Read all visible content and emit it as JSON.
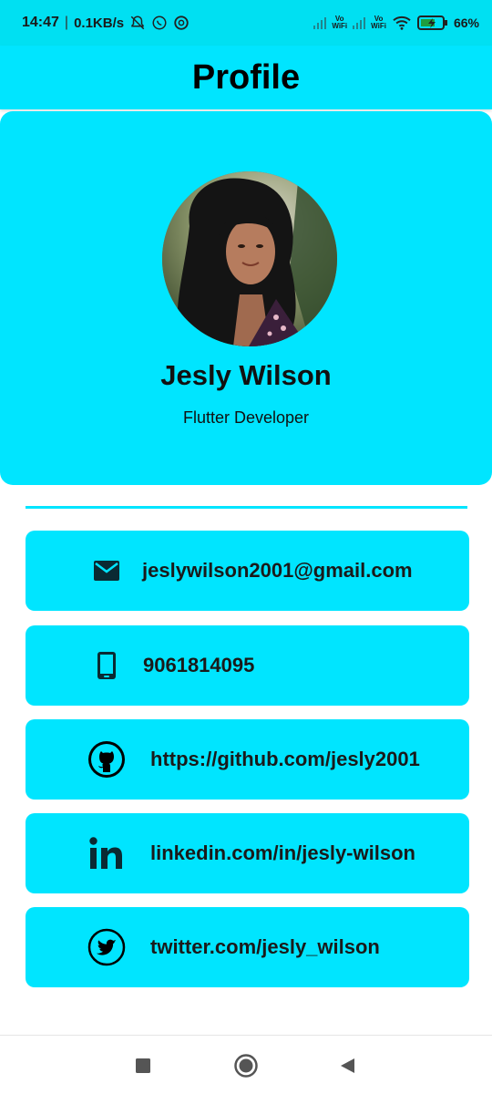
{
  "status_bar": {
    "time": "14:47",
    "net_rate": "0.1KB/s",
    "vowifi_top": "Vo",
    "vowifi_bottom": "WiFi",
    "battery": "66%"
  },
  "app_bar": {
    "title": "Profile"
  },
  "profile": {
    "name": "Jesly Wilson",
    "role": "Flutter Developer",
    "avatar_icon": "profile-photo"
  },
  "contacts": [
    {
      "icon": "mail-icon",
      "text": "jeslywilson2001@gmail.com"
    },
    {
      "icon": "phone-icon",
      "text": "9061814095"
    },
    {
      "icon": "github-icon",
      "text": "https://github.com/jesly2001"
    },
    {
      "icon": "linkedin-icon",
      "text": "linkedin.com/in/jesly-wilson"
    },
    {
      "icon": "twitter-icon",
      "text": "twitter.com/jesly_wilson"
    }
  ],
  "colors": {
    "accent": "#00E5FF",
    "text": "#111111"
  }
}
